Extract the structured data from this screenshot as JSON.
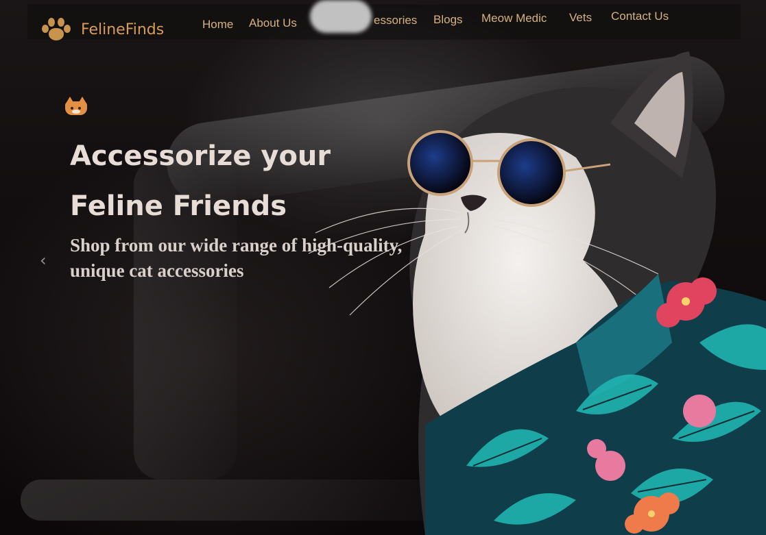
{
  "brand": {
    "name": "FelineFinds",
    "logo_icon": "paw-icon",
    "accent_color": "#d89c58"
  },
  "nav": {
    "items": [
      {
        "label": "Home"
      },
      {
        "label": "About Us"
      },
      {
        "label": "essories"
      },
      {
        "label": "Blogs"
      },
      {
        "label": "Meow Medic"
      },
      {
        "label": "Vets"
      },
      {
        "label": "Contact Us"
      }
    ]
  },
  "hero": {
    "decor_icon": "cat-face-icon",
    "title_line1": "Accessorize your",
    "title_line2": "Feline Friends",
    "subtitle": "Shop from our wide range of high-quality, unique cat accessories",
    "prev_arrow": "‹",
    "image": "cat-with-sunglasses-and-hawaiian-shirt"
  }
}
